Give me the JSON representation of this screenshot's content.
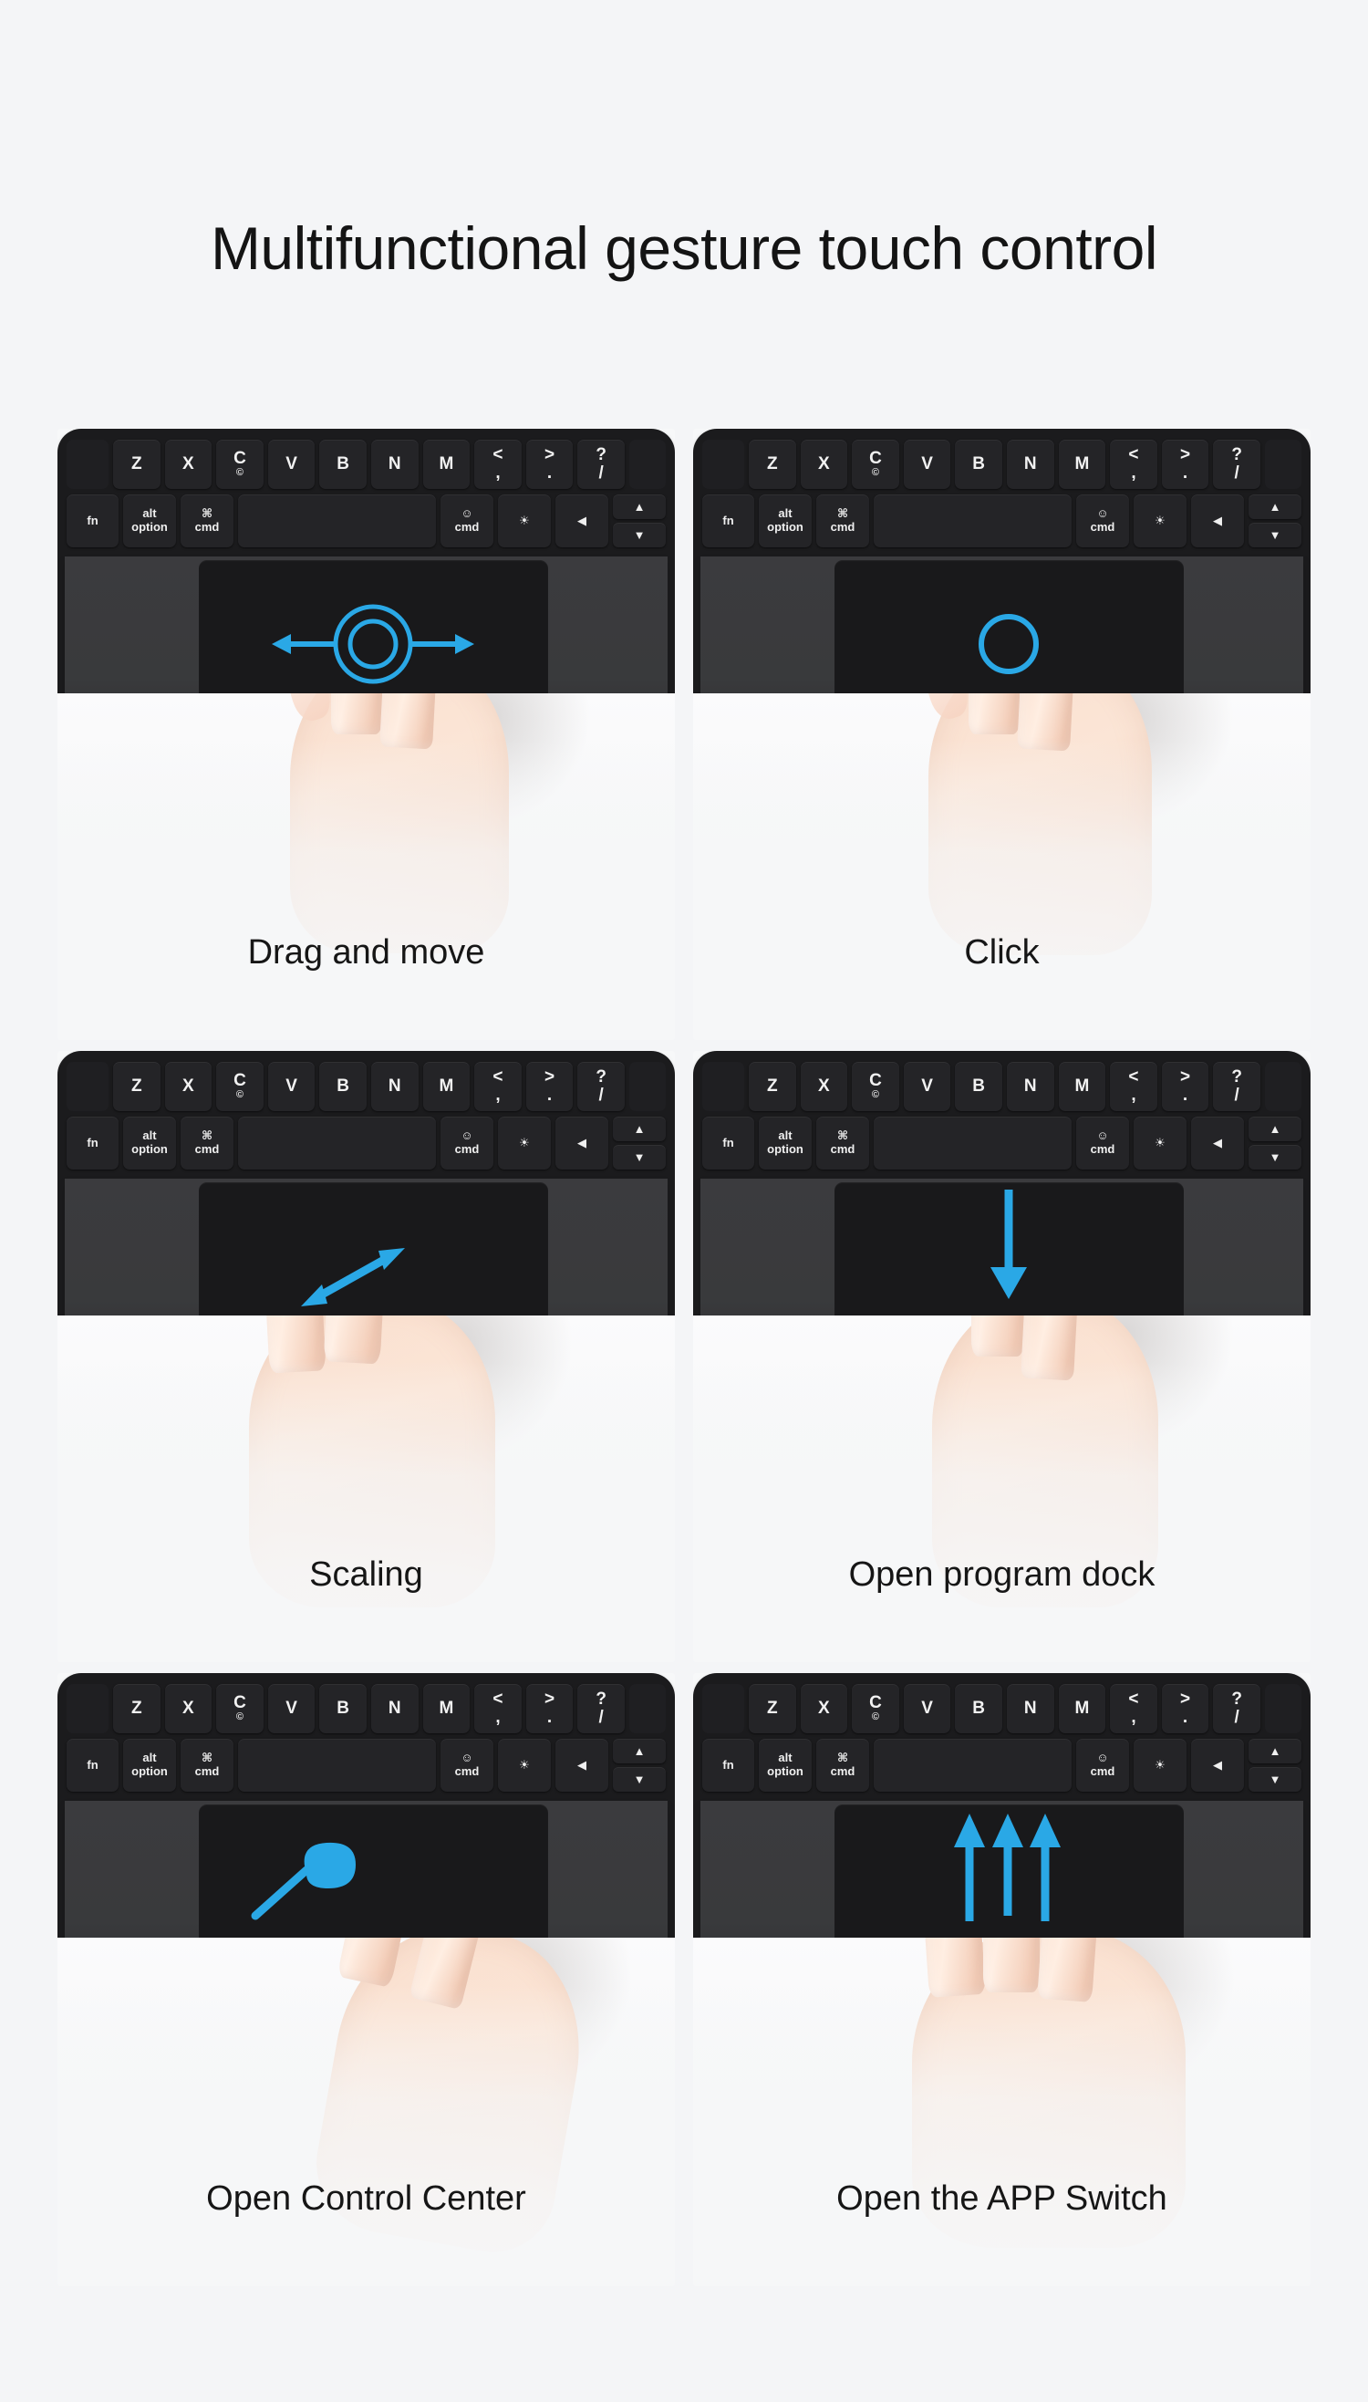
{
  "page": {
    "title": "Multifunctional gesture touch control",
    "background_color": "#f4f5f7",
    "accent_color": "#2aa8e6",
    "text_color": "#141414"
  },
  "keyboard": {
    "letter_keys": [
      {
        "label": "Z"
      },
      {
        "label": "X"
      },
      {
        "label": "C",
        "sub": "©"
      },
      {
        "label": "V"
      },
      {
        "label": "B"
      },
      {
        "label": "N"
      },
      {
        "label": "M"
      },
      {
        "top": "<",
        "bottom": ","
      },
      {
        "top": ">",
        "bottom": "."
      },
      {
        "top": "?",
        "bottom": "/"
      }
    ],
    "modifier_keys": [
      {
        "name": "fn-key",
        "l1": "fn",
        "l2": ""
      },
      {
        "name": "alt-option-key",
        "l1": "alt",
        "l2": "option"
      },
      {
        "name": "command-left-key",
        "l1": "⌘",
        "l2": "cmd"
      },
      {
        "name": "spacebar",
        "l1": "",
        "l2": ""
      },
      {
        "name": "command-right-key",
        "l1": "☺",
        "l2": "cmd"
      },
      {
        "name": "brightness-key",
        "l1": "☀",
        "l2": ""
      },
      {
        "name": "arrow-left-key",
        "l1": "◀",
        "l2": ""
      }
    ],
    "arrow_up_label": "▲",
    "arrow_down_label": "▼"
  },
  "panels": [
    {
      "id": "drag-and-move",
      "caption": "Drag and move",
      "gesture": "one finger drag left and right",
      "fingers": 1,
      "indicator": "double-ring-with-left-and-right-arrows"
    },
    {
      "id": "click",
      "caption": "Click",
      "gesture": "one finger tap",
      "fingers": 1,
      "indicator": "single-ring"
    },
    {
      "id": "scaling",
      "caption": "Scaling",
      "gesture": "two finger pinch / spread",
      "fingers": 2,
      "indicator": "diagonal-double-headed-arrow"
    },
    {
      "id": "open-program-dock",
      "caption": "Open program dock",
      "gesture": "one finger swipe down",
      "fingers": 1,
      "indicator": "down-arrow"
    },
    {
      "id": "open-control-center",
      "caption": "Open Control Center",
      "gesture": "one finger swipe from bottom-left corner",
      "fingers": 1,
      "indicator": "diagonal-swipe-trail"
    },
    {
      "id": "open-the-app-switch",
      "caption": "Open the APP Switch",
      "gesture": "three finger swipe up",
      "fingers": 3,
      "indicator": "three-up-arrows"
    }
  ]
}
